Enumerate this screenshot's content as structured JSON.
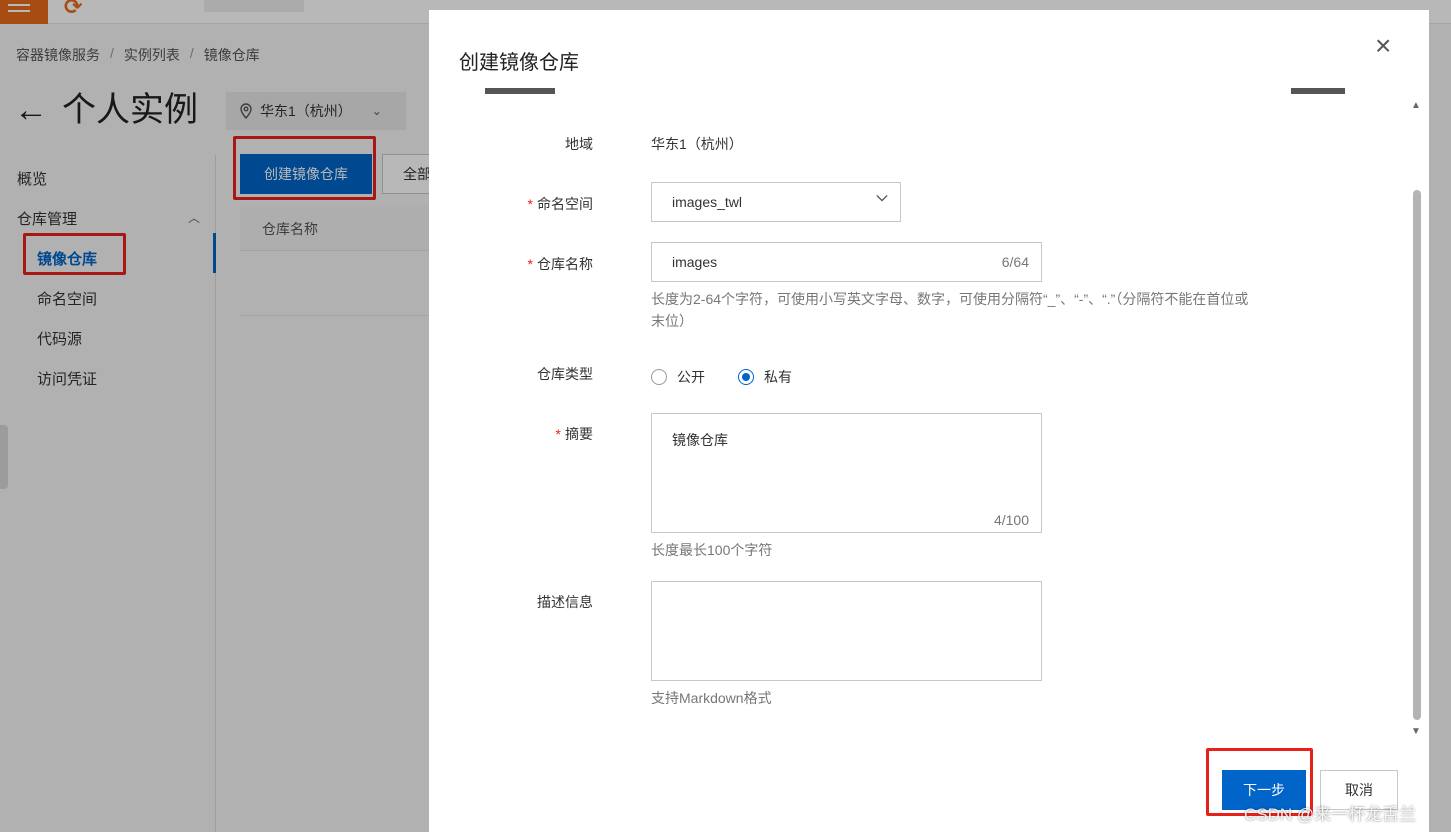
{
  "breadcrumb": [
    "容器镜像服务",
    "实例列表",
    "镜像仓库"
  ],
  "header": {
    "back_icon": "←",
    "title": "个人实例"
  },
  "region_select": {
    "value": "华东1（杭州）"
  },
  "sidebar": {
    "overview": "概览",
    "group_label": "仓库管理",
    "items": [
      {
        "label": "镜像仓库",
        "active": true
      },
      {
        "label": "命名空间"
      },
      {
        "label": "代码源"
      },
      {
        "label": "访问凭证"
      }
    ]
  },
  "main": {
    "create_button": "创建镜像仓库",
    "filter_button": "全部",
    "table_header": "仓库名称"
  },
  "dialog": {
    "title": "创建镜像仓库",
    "close_icon": "×",
    "fields": {
      "region": {
        "label": "地域",
        "value": "华东1（杭州）"
      },
      "namespace": {
        "label": "命名空间",
        "required": "*",
        "value": "images_twl"
      },
      "repo_name": {
        "label": "仓库名称",
        "required": "*",
        "value": "images",
        "counter": "6/64",
        "hint_line1": "长度为2-64个字符，可使用小写英文字母、数字，可使用分隔符“_”、“-”、“.”（分隔符不能在首位或",
        "hint_line2": "末位）"
      },
      "repo_type": {
        "label": "仓库类型",
        "options": [
          "公开",
          "私有"
        ],
        "selected": "私有"
      },
      "summary": {
        "label": "摘要",
        "required": "*",
        "value": "镜像仓库",
        "counter": "4/100",
        "hint": "长度最长100个字符"
      },
      "description": {
        "label": "描述信息",
        "value": "",
        "hint": "支持Markdown格式"
      }
    },
    "next_button": "下一步",
    "cancel_button": "取消"
  },
  "watermark": "CSDN @来一杯龙舌兰",
  "colors": {
    "primary": "#0064c8",
    "highlight": "#e8201c",
    "required": "#e8201c"
  }
}
